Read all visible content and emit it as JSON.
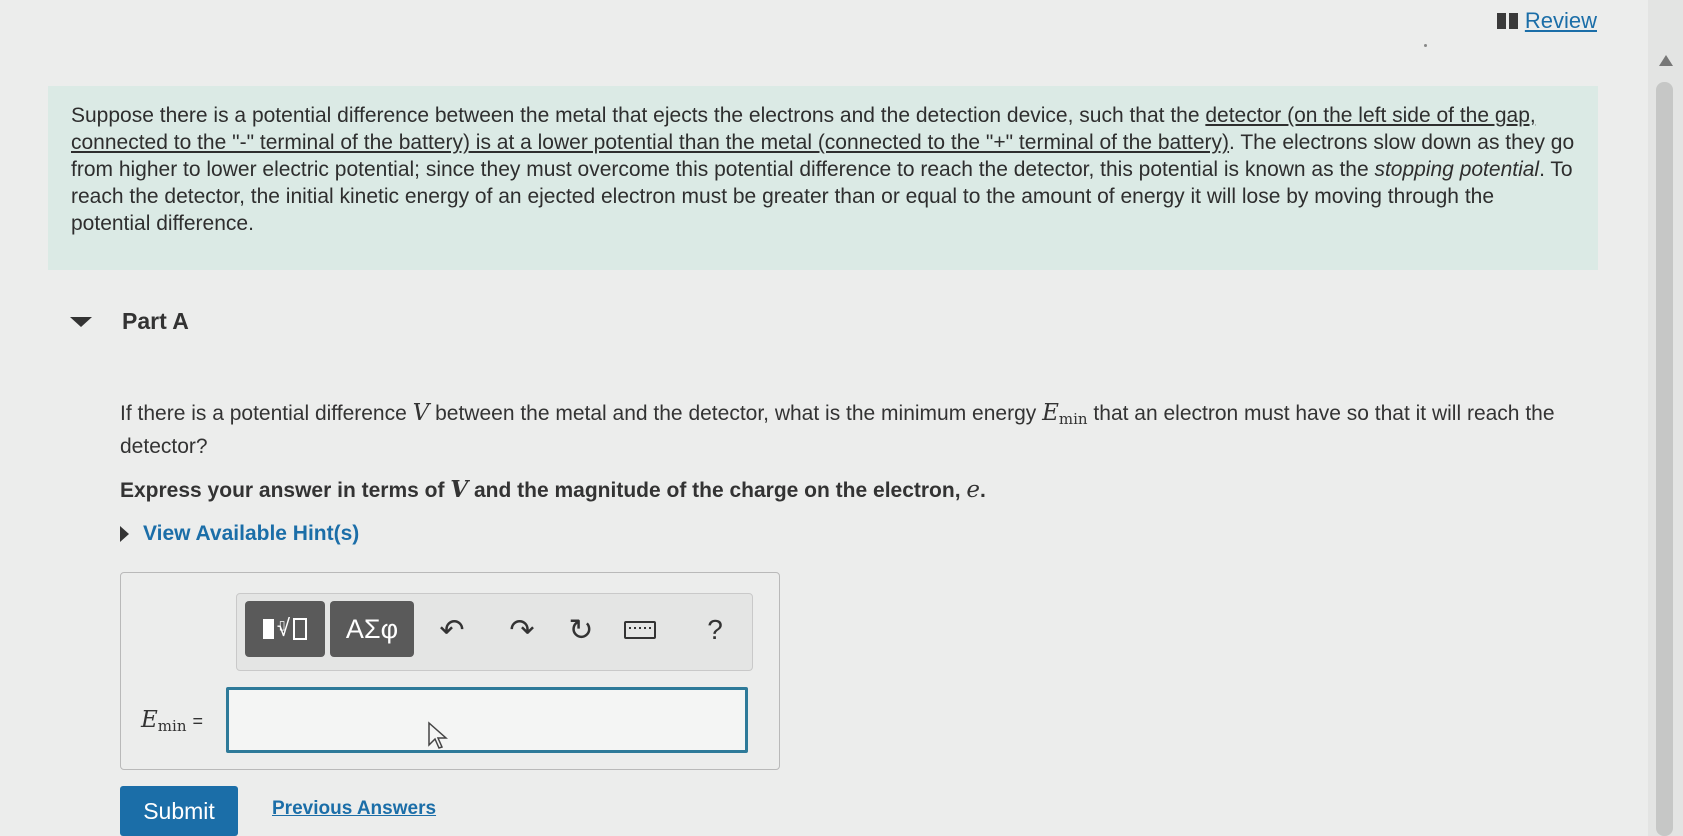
{
  "header": {
    "review_label": "Review"
  },
  "intro": {
    "text_1": "Suppose there is a potential difference between the metal that ejects the electrons and the detection device, such that the ",
    "underlined": "detector (on the left side of the gap, connected to the \"-\" terminal of the battery) is at a lower potential than the metal (connected to the \"+\" terminal of the battery)",
    "text_2": ". The electrons slow down as they go from higher to lower electric potential; since they must overcome this potential difference to reach the detector, this potential is known as the ",
    "italic": "stopping potential",
    "text_3": ". To reach the detector, the initial kinetic energy of an ejected electron must be greater than or equal to the amount of energy it will lose by moving through the potential difference."
  },
  "part": {
    "title": "Part A"
  },
  "question": {
    "text_1": "If there is a potential difference ",
    "var_v": "V",
    "text_2": " between the metal and the detector, what is the minimum energy ",
    "var_e": "E",
    "var_e_sub": "min",
    "text_3": " that an electron must have so that it will reach the detector?"
  },
  "instruction": {
    "text_1": "Express your answer in terms of ",
    "var_v": "V",
    "text_2": " and the magnitude of the charge on the electron, ",
    "var_e": "e",
    "text_3": "."
  },
  "hints": {
    "label": "View Available Hint(s)"
  },
  "toolbar": {
    "symbols_label": "ΑΣφ",
    "undo_glyph": "↶",
    "redo_glyph": "↷",
    "reset_glyph": "↻",
    "help_label": "?",
    "icons": [
      "templates-icon",
      "symbols-icon",
      "undo-icon",
      "redo-icon",
      "reset-icon",
      "keyboard-icon",
      "help-icon"
    ]
  },
  "answer": {
    "label_var": "E",
    "label_sub": "min",
    "label_eq": "=",
    "value": ""
  },
  "actions": {
    "submit_label": "Submit",
    "previous_answers_label": "Previous Answers"
  },
  "colors": {
    "accent": "#1b6ea8",
    "intro_bg": "#dbeae5",
    "input_border": "#2e7a99",
    "page_bg": "#ecedec"
  }
}
